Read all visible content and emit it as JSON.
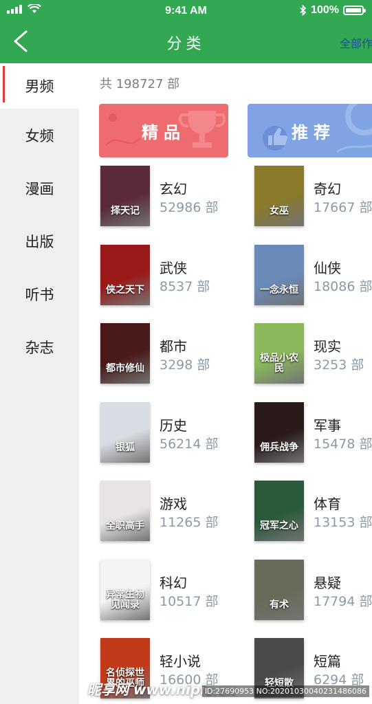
{
  "status_bar": {
    "time": "9:41 AM",
    "battery": "100%"
  },
  "nav": {
    "title": "分类",
    "right_action": "全部作"
  },
  "sidebar": {
    "items": [
      {
        "label": "男频",
        "active": true
      },
      {
        "label": "女频",
        "active": false
      },
      {
        "label": "漫画",
        "active": false
      },
      {
        "label": "出版",
        "active": false
      },
      {
        "label": "听书",
        "active": false
      },
      {
        "label": "杂志",
        "active": false
      }
    ]
  },
  "main": {
    "total": "共 198727 部",
    "banners": [
      {
        "label": "精品",
        "color": "#ee6b6f"
      },
      {
        "label": "推荐",
        "color": "#7fa3e3"
      }
    ],
    "categories": [
      {
        "name": "玄幻",
        "count": "52986 部",
        "cover_text": "择天记",
        "cover_color": "#5a2a3a"
      },
      {
        "name": "奇幻",
        "count": "17667 部",
        "cover_text": "女巫",
        "cover_color": "#8a7a2a"
      },
      {
        "name": "武侠",
        "count": "8537 部",
        "cover_text": "侠之天下",
        "cover_color": "#9a1a1a"
      },
      {
        "name": "仙侠",
        "count": "18086 部",
        "cover_text": "一念永恒",
        "cover_color": "#6a8ab8"
      },
      {
        "name": "都市",
        "count": "3298 部",
        "cover_text": "都市修仙",
        "cover_color": "#4a1a1a"
      },
      {
        "name": "现实",
        "count": "3253 部",
        "cover_text": "极品小农民",
        "cover_color": "#8ab85a"
      },
      {
        "name": "历史",
        "count": "56214 部",
        "cover_text": "银狐",
        "cover_color": "#d8dde3"
      },
      {
        "name": "军事",
        "count": "15478 部",
        "cover_text": "佣兵战争",
        "cover_color": "#2a1a1a"
      },
      {
        "name": "游戏",
        "count": "11265 部",
        "cover_text": "全职高手",
        "cover_color": "#e8e4e4"
      },
      {
        "name": "体育",
        "count": "13153 部",
        "cover_text": "冠军之心",
        "cover_color": "#2a5a3a"
      },
      {
        "name": "科幻",
        "count": "10517 部",
        "cover_text": "异常生物见闻录",
        "cover_color": "#f4f4f2"
      },
      {
        "name": "悬疑",
        "count": "17794 部",
        "cover_text": "有术",
        "cover_color": "#6a6a5a"
      },
      {
        "name": "轻小说",
        "count": "16600 部",
        "cover_text": "名侦探世界的巫师",
        "cover_color": "#c23a1a"
      },
      {
        "name": "短篇",
        "count": "6294 部",
        "cover_text": "轻短散",
        "cover_color": "#4a4a4a"
      }
    ]
  },
  "watermark": {
    "logo": "昵享网 www.nipic.cn",
    "id_text": "ID:27690953 NO:20201030040231486086"
  },
  "colors": {
    "header": "#33a852",
    "sidebar_bg": "#efefef",
    "active_marker": "#e23a3a"
  }
}
